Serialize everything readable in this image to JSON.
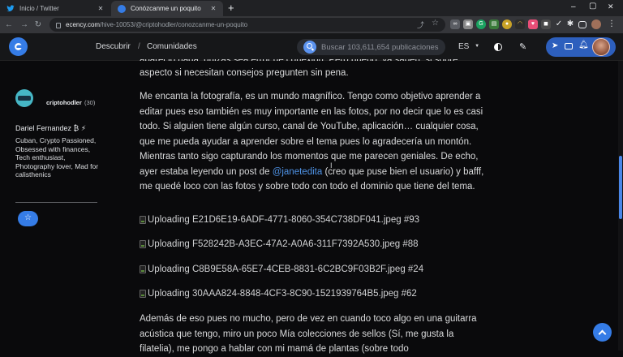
{
  "browser": {
    "tabs": [
      {
        "title": "Inicio / Twitter",
        "close": "✕"
      },
      {
        "title": "Conózcanme un poquito",
        "close": "✕"
      }
    ],
    "new_tab": "+",
    "window_controls": {
      "minimize": "–",
      "maximize": "▢",
      "close": "✕"
    },
    "url_domain": "ecency.com",
    "url_path": "/hive-10053/@criptohodler/conozcanme-un-poquito"
  },
  "site": {
    "nav_discover": "Descubrir",
    "nav_separator": "/",
    "nav_communities": "Comunidades",
    "search_placeholder": "Buscar 103,611,654 publicaciones",
    "language": "ES",
    "accent_color": "#357ce6"
  },
  "author": {
    "username": "criptohodler",
    "reputation": "(30)",
    "display_name": "Dariel Fernandez ₿ ⚡",
    "bio": "Cuban, Crypto Passioned, Obsessed with finances, Tech enthusiast, Photography lover, Mad for calisthenics"
  },
  "post": {
    "top_partial": "apareció nada, quizás sea error de conexión. Pero bueno, ya saben, si sobre",
    "top_line": "aspecto si necesitan consejos pregunten sin pena.",
    "p2": {
      "before_mention": "Me encanta la fotografía, es un mundo magnífico. Tengo como objetivo aprender a editar pues eso también es muy importante en las fotos, por no decir que lo es casi todo. Si alguien tiene algún curso, canal de YouTube, aplicación… cualquier cosa, que me pueda ayudar a aprender sobre el tema pues lo agradecería un montón. Mientras tanto sigo capturando los momentos que me parecen geniales. De echo, ayer estaba leyendo un post de ",
      "mention": "@janetedita",
      "after_mention": " (creo que puse bien el usuario) y bafff, me quedé loco con las fotos y sobre todo con todo el dominio que tiene del tema."
    },
    "uploads": [
      "Uploading E21D6E19-6ADF-4771-8060-354C738DF041.jpeg #93",
      "Uploading F528242B-A3EC-47A2-A0A6-311F7392A530.jpeg #88",
      "Uploading C8B9E58A-65E7-4CEB-8831-6C2BC9F03B2F.jpeg #24",
      "Uploading 30AAA824-8848-4CF3-8C90-1521939764B5.jpeg #62"
    ],
    "p3": "Además de eso pues no mucho, pero de vez en cuando toco algo en una guitarra acústica que tengo, miro un poco Mía colecciones de sellos (Sí, me gusta la filatelia), me pongo a hablar con mi mamá de plantas (sobre todo"
  }
}
